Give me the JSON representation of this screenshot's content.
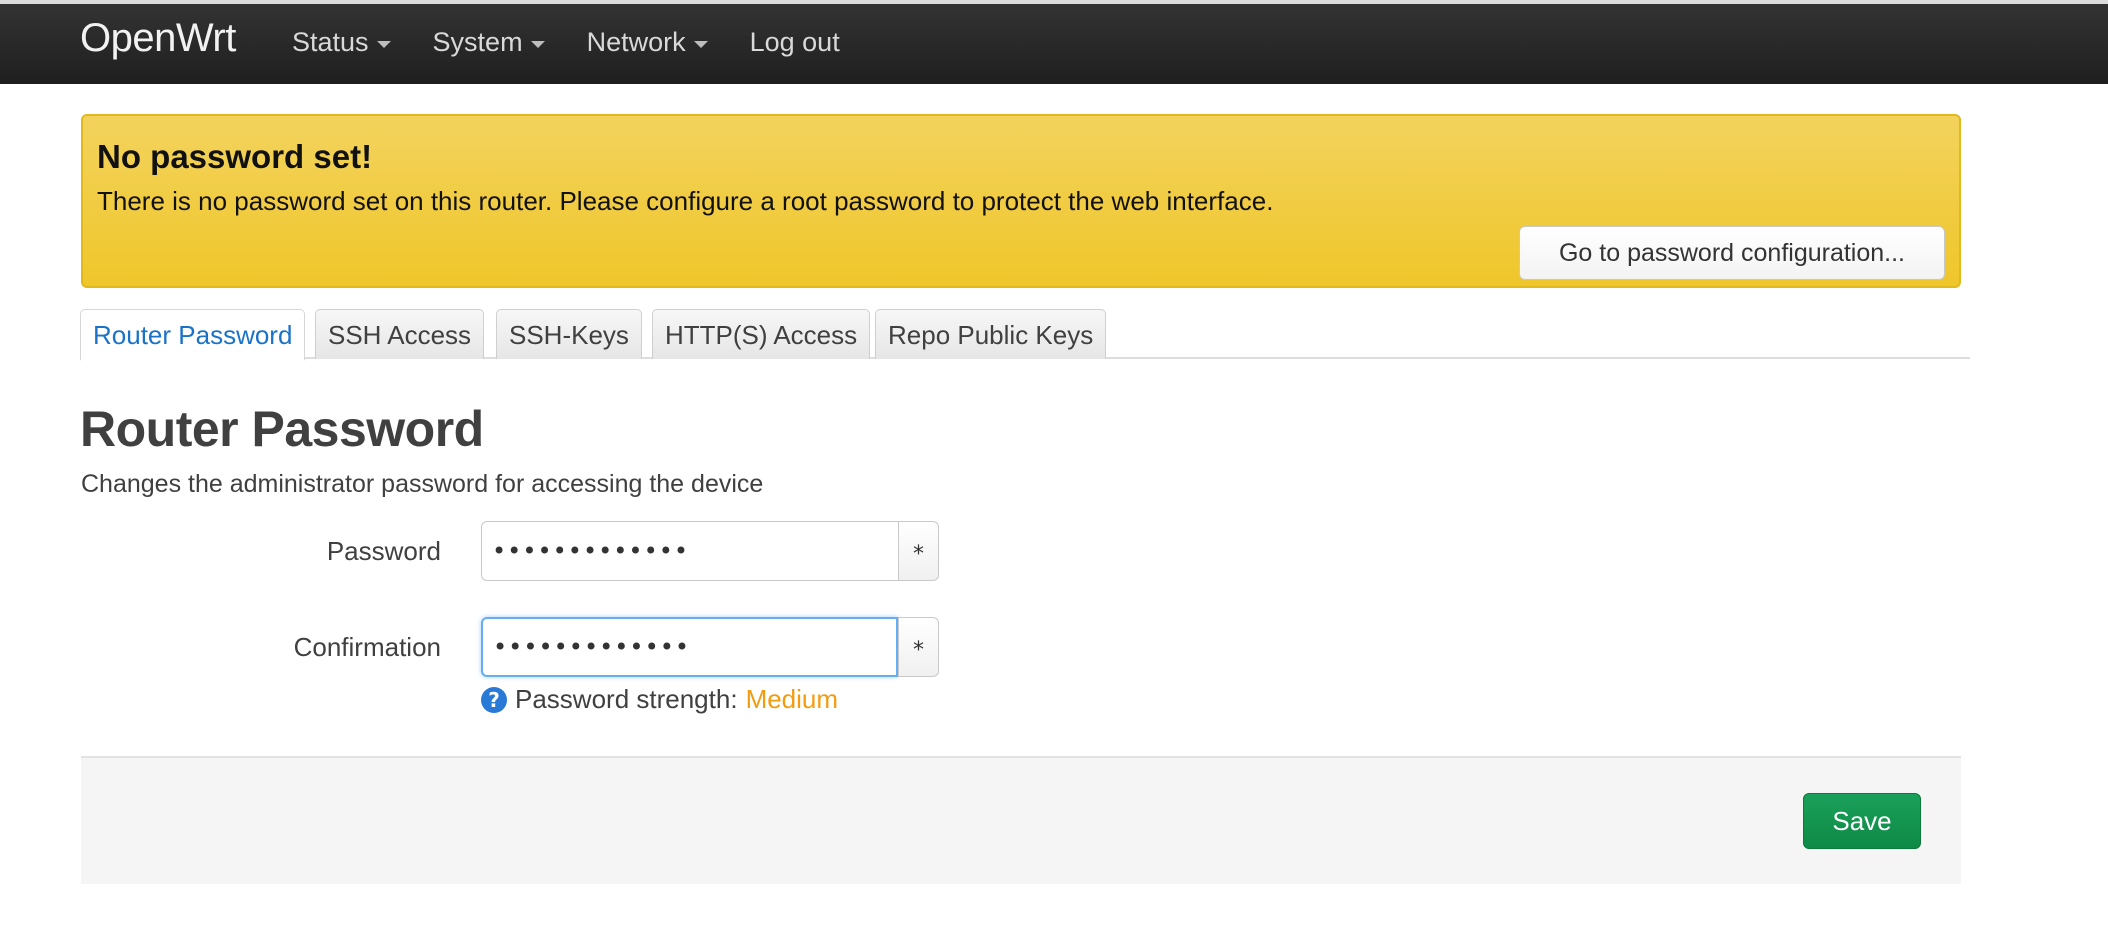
{
  "header": {
    "brand": "OpenWrt",
    "nav": [
      {
        "label": "Status",
        "dropdown": true
      },
      {
        "label": "System",
        "dropdown": true
      },
      {
        "label": "Network",
        "dropdown": true
      },
      {
        "label": "Log out",
        "dropdown": false
      }
    ]
  },
  "alert": {
    "title": "No password set!",
    "message": "There is no password set on this router. Please configure a root password to protect the web interface.",
    "button_label": "Go to password configuration..."
  },
  "tabs": [
    {
      "label": "Router Password",
      "active": true
    },
    {
      "label": "SSH Access",
      "active": false
    },
    {
      "label": "SSH-Keys",
      "active": false
    },
    {
      "label": "HTTP(S) Access",
      "active": false
    },
    {
      "label": "Repo Public Keys",
      "active": false
    }
  ],
  "section": {
    "title": "Router Password",
    "description": "Changes the administrator password for accessing the device"
  },
  "form": {
    "password": {
      "label": "Password",
      "value": "•••••••••••••",
      "reveal_label": "*"
    },
    "confirmation": {
      "label": "Confirmation",
      "value": "•••••••••••••",
      "reveal_label": "*"
    },
    "strength": {
      "help_glyph": "?",
      "label": "Password strength:",
      "value": "Medium"
    }
  },
  "footer": {
    "save_label": "Save"
  },
  "colors": {
    "accent": "#1a73c9",
    "warning": "#efc62a",
    "success": "#0e8a46",
    "strength_medium": "#f39c12"
  }
}
